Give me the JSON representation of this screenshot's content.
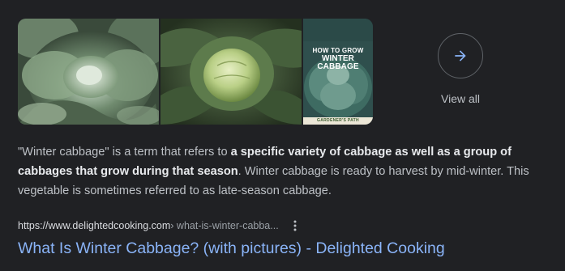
{
  "images": {
    "items": [
      {
        "alt": "frosted winter cabbage plants"
      },
      {
        "alt": "winter cabbage head"
      },
      {
        "alt": "how to grow winter cabbage pin"
      }
    ],
    "pin_title_line1": "HOW TO GROW",
    "pin_title_line2": "WINTER CABBAGE",
    "pin_footer": "GARDENER'S PATH"
  },
  "view_all": {
    "label": "View all",
    "icon": "arrow-right-icon",
    "accent_color": "#8ab4f8"
  },
  "snippet": {
    "part1": "\"Winter cabbage\" is a term that refers to ",
    "bold": "a specific variety of cabbage as well as a group of cabbages that grow during that season",
    "part2": ". Winter cabbage is ready to harvest by mid-winter. This vegetable is sometimes referred to as late-season cabbage."
  },
  "result": {
    "domain": "https://www.delightedcooking.com",
    "path": " › what-is-winter-cabba...",
    "more_icon": "more-vert-icon",
    "title": "What Is Winter Cabbage? (with pictures) - Delighted Cooking"
  },
  "colors": {
    "background": "#202124",
    "link": "#8ab4f8",
    "text": "#bdc1c6",
    "bold_text": "#e8eaed"
  }
}
